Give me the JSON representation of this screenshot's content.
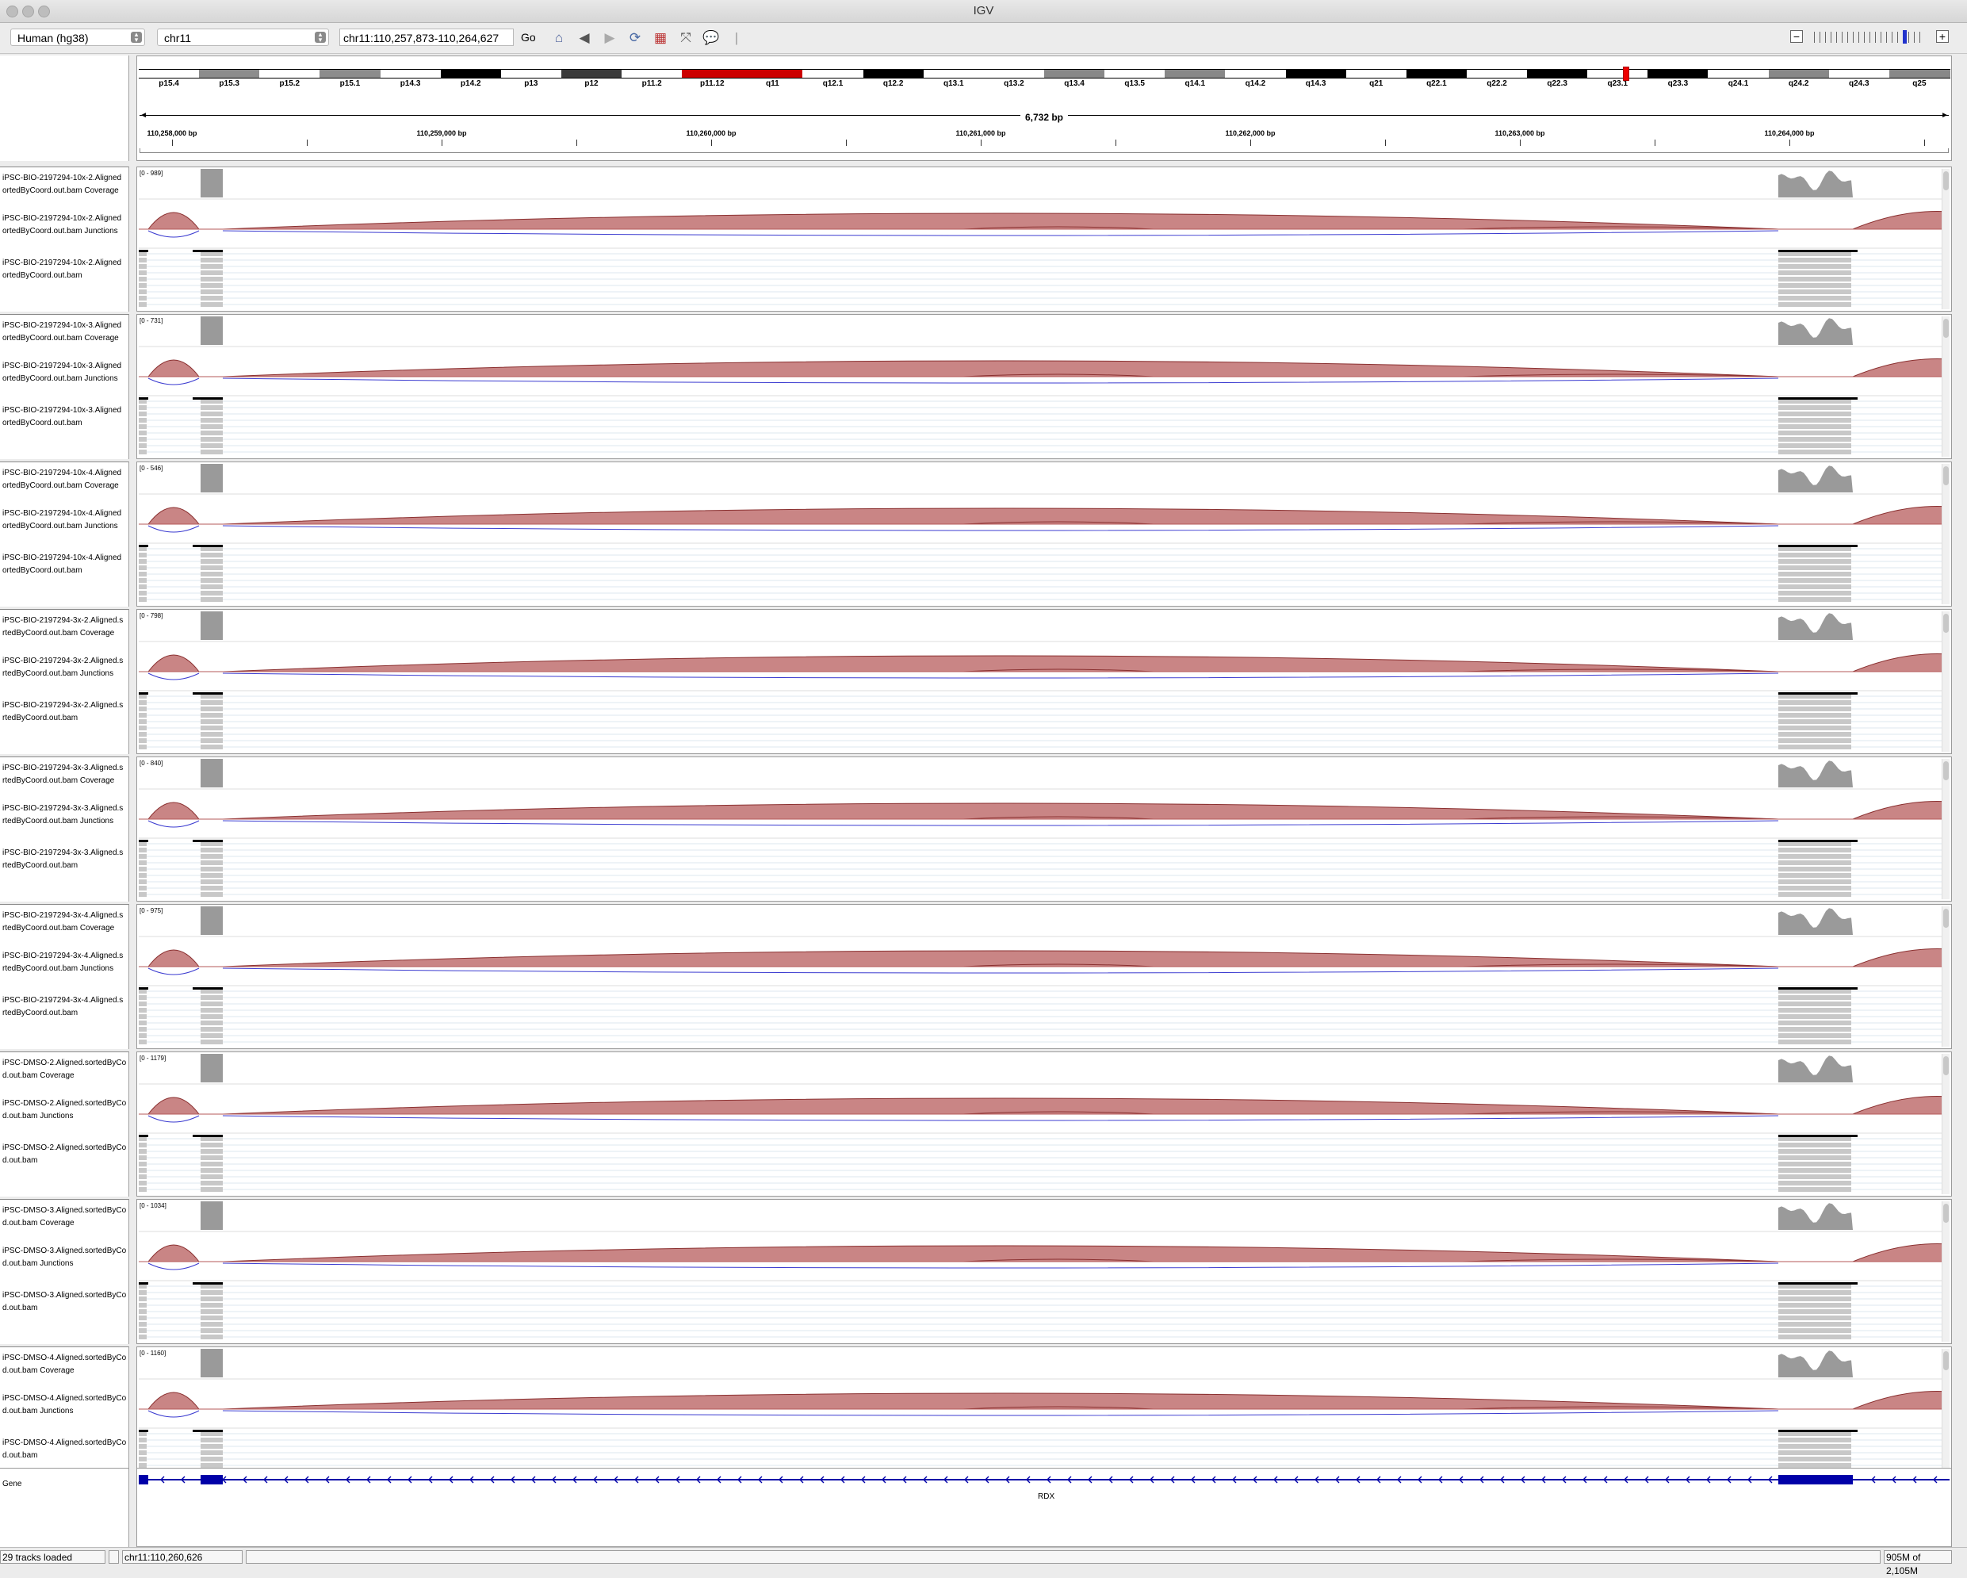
{
  "window": {
    "title": "IGV"
  },
  "toolbar": {
    "genome": "Human (hg38)",
    "chromosome": "chr11",
    "locus": "chr11:110,257,873-110,264,627",
    "go_label": "Go",
    "zoom_minus": "−",
    "zoom_plus": "+"
  },
  "ideogram": {
    "bands": [
      "p15.4",
      "p15.3",
      "p15.2",
      "p15.1",
      "p14.3",
      "p14.2",
      "p13",
      "p12",
      "p11.2",
      "p11.12",
      "q11",
      "q12.1",
      "q12.2",
      "q13.1",
      "q13.2",
      "q13.4",
      "q13.5",
      "q14.1",
      "q14.2",
      "q14.3",
      "q21",
      "q22.1",
      "q22.2",
      "q22.3",
      "q23.1",
      "q23.3",
      "q24.1",
      "q24.2",
      "q24.3",
      "q25"
    ]
  },
  "ruler": {
    "span": "6,732 bp",
    "ticks": [
      "110,258,000 bp",
      "110,259,000 bp",
      "110,260,000 bp",
      "110,261,000 bp",
      "110,262,000 bp",
      "110,263,000 bp",
      "110,264,000 bp"
    ]
  },
  "samples": [
    {
      "coverage": [
        "iPSC-BIO-2197294-10x-2.Aligned",
        "ortedByCoord.out.bam Coverage"
      ],
      "junctions": [
        "iPSC-BIO-2197294-10x-2.Aligned",
        "ortedByCoord.out.bam Junctions"
      ],
      "bam": [
        "iPSC-BIO-2197294-10x-2.Aligned",
        "ortedByCoord.out.bam"
      ],
      "range": "[0 - 989]"
    },
    {
      "coverage": [
        "iPSC-BIO-2197294-10x-3.Aligned",
        "ortedByCoord.out.bam Coverage"
      ],
      "junctions": [
        "iPSC-BIO-2197294-10x-3.Aligned",
        "ortedByCoord.out.bam Junctions"
      ],
      "bam": [
        "iPSC-BIO-2197294-10x-3.Aligned",
        "ortedByCoord.out.bam"
      ],
      "range": "[0 - 731]"
    },
    {
      "coverage": [
        "iPSC-BIO-2197294-10x-4.Aligned",
        "ortedByCoord.out.bam Coverage"
      ],
      "junctions": [
        "iPSC-BIO-2197294-10x-4.Aligned",
        "ortedByCoord.out.bam Junctions"
      ],
      "bam": [
        "iPSC-BIO-2197294-10x-4.Aligned",
        "ortedByCoord.out.bam"
      ],
      "range": "[0 - 546]"
    },
    {
      "coverage": [
        "iPSC-BIO-2197294-3x-2.Aligned.s",
        "rtedByCoord.out.bam Coverage"
      ],
      "junctions": [
        "iPSC-BIO-2197294-3x-2.Aligned.s",
        "rtedByCoord.out.bam Junctions"
      ],
      "bam": [
        "iPSC-BIO-2197294-3x-2.Aligned.s",
        "rtedByCoord.out.bam"
      ],
      "range": "[0 - 798]"
    },
    {
      "coverage": [
        "iPSC-BIO-2197294-3x-3.Aligned.s",
        "rtedByCoord.out.bam Coverage"
      ],
      "junctions": [
        "iPSC-BIO-2197294-3x-3.Aligned.s",
        "rtedByCoord.out.bam Junctions"
      ],
      "bam": [
        "iPSC-BIO-2197294-3x-3.Aligned.s",
        "rtedByCoord.out.bam"
      ],
      "range": "[0 - 840]"
    },
    {
      "coverage": [
        "iPSC-BIO-2197294-3x-4.Aligned.s",
        "rtedByCoord.out.bam Coverage"
      ],
      "junctions": [
        "iPSC-BIO-2197294-3x-4.Aligned.s",
        "rtedByCoord.out.bam Junctions"
      ],
      "bam": [
        "iPSC-BIO-2197294-3x-4.Aligned.s",
        "rtedByCoord.out.bam"
      ],
      "range": "[0 - 975]"
    },
    {
      "coverage": [
        "iPSC-DMSO-2.Aligned.sortedByCo",
        "d.out.bam Coverage"
      ],
      "junctions": [
        "iPSC-DMSO-2.Aligned.sortedByCo",
        "d.out.bam Junctions"
      ],
      "bam": [
        "iPSC-DMSO-2.Aligned.sortedByCo",
        "d.out.bam"
      ],
      "range": "[0 - 1179]"
    },
    {
      "coverage": [
        "iPSC-DMSO-3.Aligned.sortedByCo",
        "d.out.bam Coverage"
      ],
      "junctions": [
        "iPSC-DMSO-3.Aligned.sortedByCo",
        "d.out.bam Junctions"
      ],
      "bam": [
        "iPSC-DMSO-3.Aligned.sortedByCo",
        "d.out.bam"
      ],
      "range": "[0 - 1034]"
    },
    {
      "coverage": [
        "iPSC-DMSO-4.Aligned.sortedByCo",
        "d.out.bam Coverage"
      ],
      "junctions": [
        "iPSC-DMSO-4.Aligned.sortedByCo",
        "d.out.bam Junctions"
      ],
      "bam": [
        "iPSC-DMSO-4.Aligned.sortedByCo",
        "d.out.bam"
      ],
      "range": "[0 - 1160]"
    }
  ],
  "gene_track": {
    "name": "Gene",
    "gene": "RDX"
  },
  "status": {
    "tracks": "29 tracks loaded",
    "position": "chr11:110,260,626",
    "memory": "905M of 2,105M"
  },
  "colors": {
    "coverage": "#9a9a9a",
    "junction_plus": "#b55a5a",
    "junction_minus": "#3b3bd0",
    "read": "#c8c8c8",
    "gene": "#0000a8"
  }
}
